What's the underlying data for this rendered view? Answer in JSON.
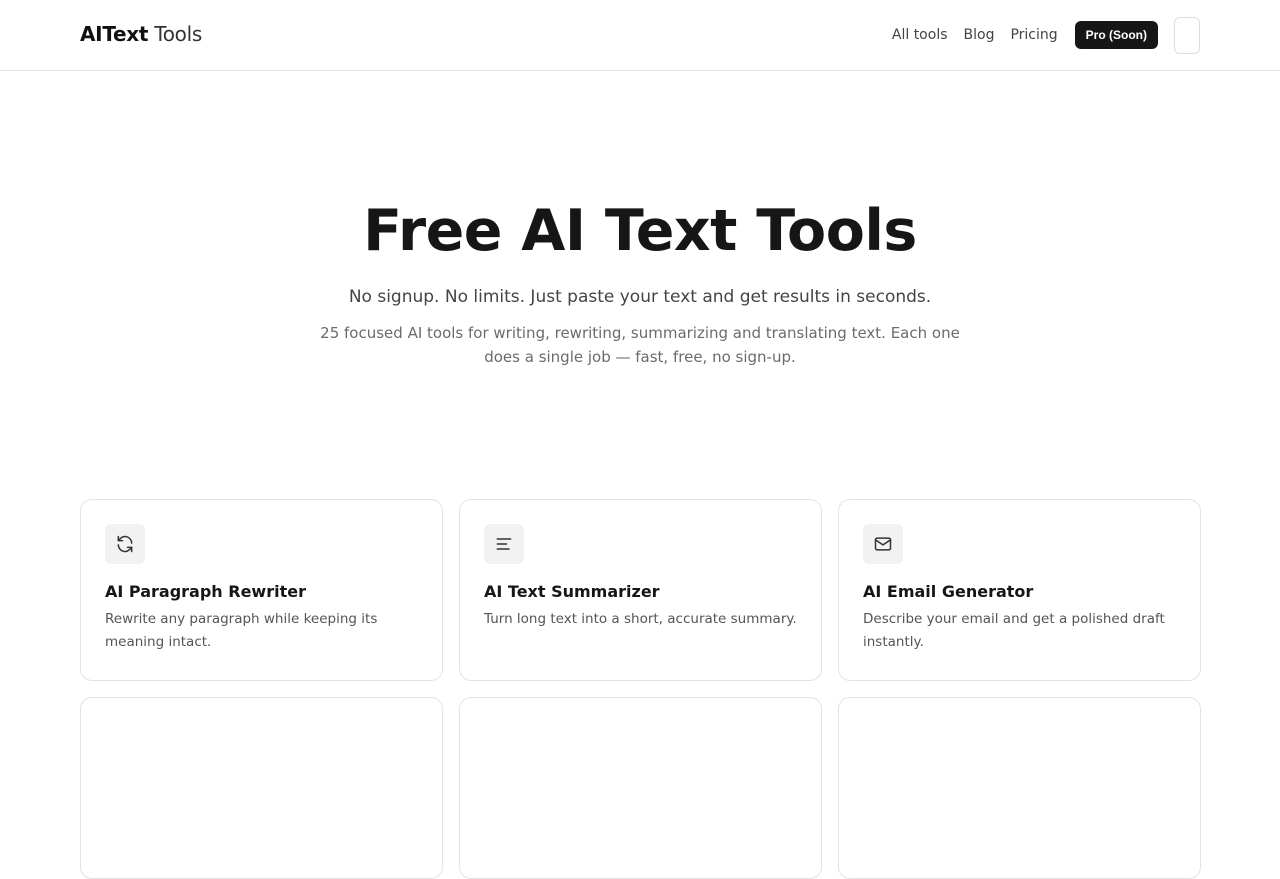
{
  "brand": {
    "strong": "AIText",
    "light": "Tools"
  },
  "nav": {
    "links": [
      "All tools",
      "Blog",
      "Pricing"
    ],
    "cta": "Pro (Soon)"
  },
  "hero": {
    "title": "Free AI Text Tools",
    "subtitle": "No signup. No limits. Just paste your text and get results in seconds.",
    "description": "25 focused AI tools for writing, rewriting, summarizing and translating text. Each one does a single job — fast, free, no sign-up."
  },
  "tools": [
    {
      "icon": "refresh-icon",
      "title": "AI Paragraph Rewriter",
      "description": "Rewrite any paragraph while keeping its meaning intact."
    },
    {
      "icon": "text-lines-icon",
      "title": "AI Text Summarizer",
      "description": "Turn long text into a short, accurate summary."
    },
    {
      "icon": "mail-icon",
      "title": "AI Email Generator",
      "description": "Describe your email and get a polished draft instantly."
    },
    {
      "icon": "",
      "title": "",
      "description": ""
    },
    {
      "icon": "",
      "title": "",
      "description": ""
    },
    {
      "icon": "",
      "title": "",
      "description": ""
    }
  ]
}
